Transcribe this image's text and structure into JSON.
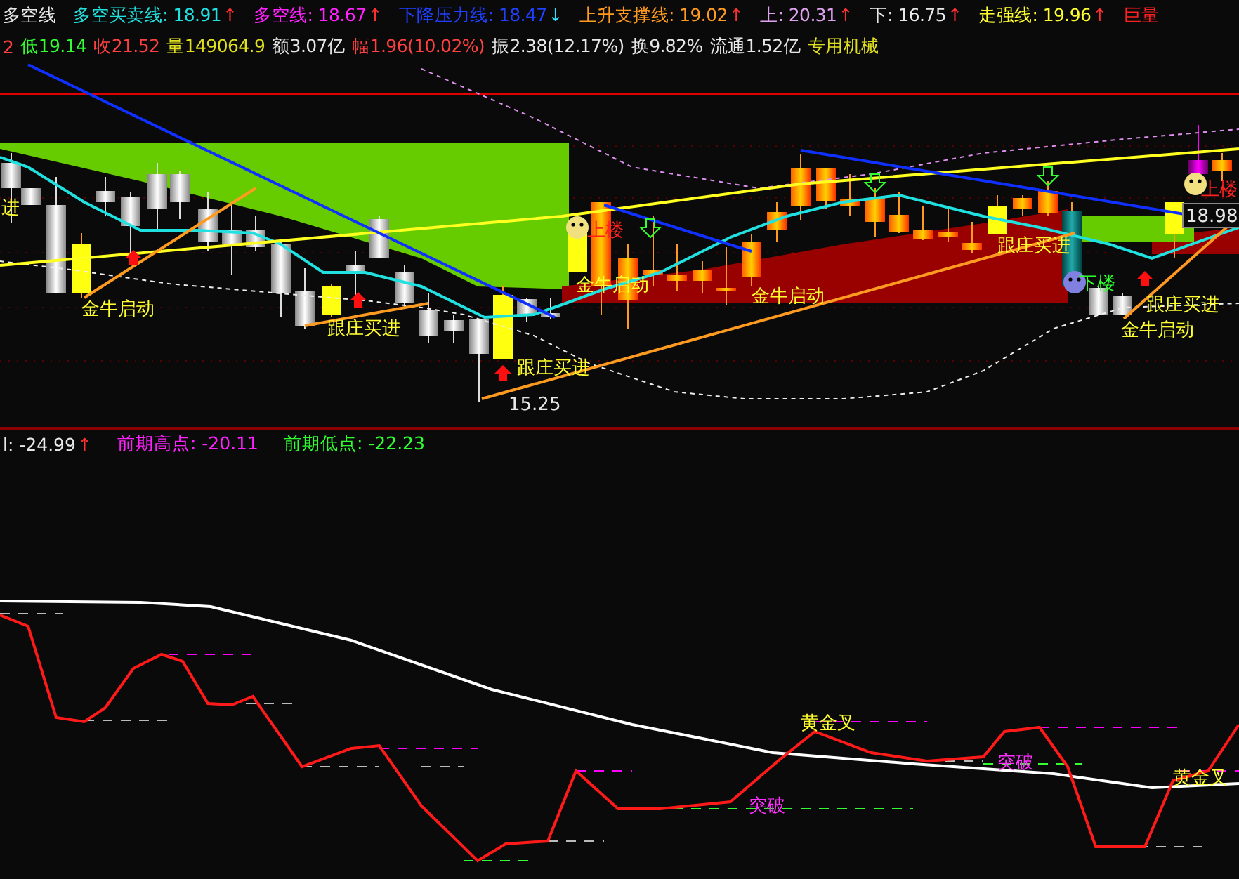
{
  "indicator_bar": {
    "title": "多空线",
    "items": [
      {
        "label": "多空买卖线:",
        "value": "18.91",
        "arrow": {
          "text": "↑",
          "color": "#ff3030"
        },
        "color": "#22e0e0"
      },
      {
        "label": "多空线:",
        "value": "18.67",
        "arrow": {
          "text": "↑",
          "color": "#ff3030"
        },
        "color": "#ff22ff"
      },
      {
        "label": "下降压力线:",
        "value": "18.47",
        "arrow": {
          "text": "↓",
          "color": "#30e0ff"
        },
        "color": "#2040ff"
      },
      {
        "label": "上升支撑线:",
        "value": "19.02",
        "arrow": {
          "text": "↑",
          "color": "#ff3030"
        },
        "color": "#ff9a20"
      },
      {
        "label": "上:",
        "value": "20.31",
        "arrow": {
          "text": "↑",
          "color": "#ff3030"
        },
        "color": "#e0a0f0"
      },
      {
        "label": "下:",
        "value": "16.75",
        "arrow": {
          "text": "↑",
          "color": "#ff3030"
        },
        "color": "#e8e8e8"
      },
      {
        "label": "走强线:",
        "value": "19.96",
        "arrow": {
          "text": "↑",
          "color": "#ff3030"
        },
        "color": "#ffff30"
      }
    ],
    "cut_label": "巨量"
  },
  "quote_bar": [
    {
      "text": "2",
      "color": "#ff4040"
    },
    {
      "text": "低19.14",
      "color": "#30ff30"
    },
    {
      "text": "收21.52",
      "color": "#ff4040"
    },
    {
      "text": "量149064.9",
      "color": "#e0e020"
    },
    {
      "text": "额3.07亿",
      "color": "#e8e8e8"
    },
    {
      "text": "幅1.96(10.02%)",
      "color": "#ff4040"
    },
    {
      "text": "振2.38(12.17%)",
      "color": "#e8e8e8"
    },
    {
      "text": "换9.82%",
      "color": "#e8e8e8"
    },
    {
      "text": "流通1.52亿",
      "color": "#e8e8e8"
    },
    {
      "text": "专用机械",
      "color": "#e0e020"
    }
  ],
  "main_chart": {
    "signals": [
      {
        "text": "进",
        "kind": "buy"
      },
      {
        "text": "金牛启动",
        "kind": "buy"
      },
      {
        "text": "跟庄买进",
        "kind": "buy"
      },
      {
        "text": "跟庄买进",
        "kind": "buy"
      },
      {
        "text": "15.25",
        "kind": "price"
      },
      {
        "text": "上楼",
        "kind": "up"
      },
      {
        "text": "金牛启动",
        "kind": "buy"
      },
      {
        "text": "金牛启动",
        "kind": "buy"
      },
      {
        "text": "跟庄买进",
        "kind": "buy"
      },
      {
        "text": "下楼",
        "kind": "down"
      },
      {
        "text": "跟庄买进",
        "kind": "buy"
      },
      {
        "text": "金牛启动",
        "kind": "buy"
      },
      {
        "text": "上楼",
        "kind": "up"
      },
      {
        "text": "18.98",
        "kind": "tag"
      }
    ]
  },
  "sub_indicator_bar": [
    {
      "label": "l:",
      "value": "-24.99",
      "arrow": {
        "text": "↑",
        "color": "#ff3030"
      },
      "color": "#e8e8e8"
    },
    {
      "label": "前期高点:",
      "value": "-20.11",
      "color": "#ff22ff"
    },
    {
      "label": "前期低点:",
      "value": "-22.23",
      "color": "#30ff30"
    }
  ],
  "sub_chart": {
    "signals": [
      {
        "text": "黄金叉",
        "kind": "cross"
      },
      {
        "text": "突破",
        "kind": "breakout"
      },
      {
        "text": "突破",
        "kind": "breakout"
      },
      {
        "text": "黄金叉",
        "kind": "cross"
      }
    ]
  }
}
